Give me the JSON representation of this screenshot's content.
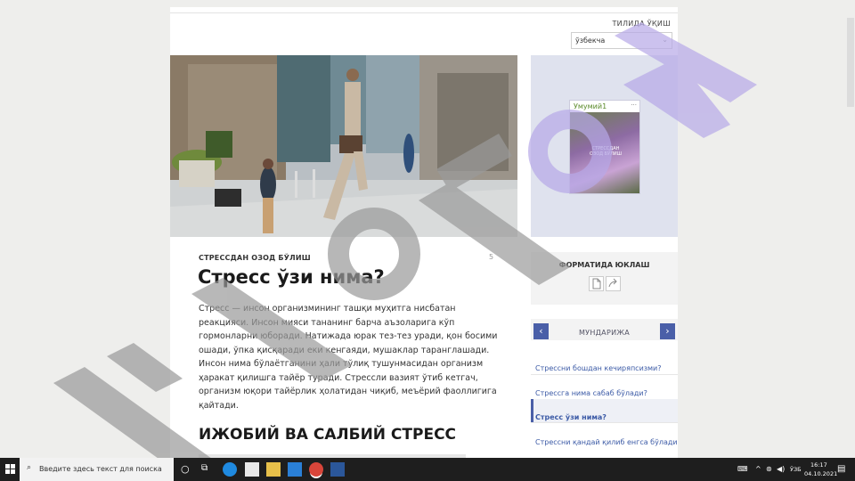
{
  "language": {
    "label": "ТИЛИДА ЎҚИШ",
    "selected": "ўзбекча"
  },
  "hero": {
    "alt": ""
  },
  "promo": {
    "title": "Умумий1",
    "caption": "СТРЕССДАН ОЗОД БЎЛИШ"
  },
  "article": {
    "eyebrow": "СТРЕССДАН ОЗОД БЎЛИШ",
    "marker": "5",
    "title": "Стресс ўзи нима?",
    "paragraph_lines": [
      "Стресс — инсон организмининг ташқи муҳитга нисбатан",
      "реакцияси. Инсон мияси тананинг барча аъзоларига кўп",
      "гормонларни юборади. Натижада юрак тез-тез уради, қон босими",
      "ошади, ўпка қисқаради еки кенгаяди, мушаклар таранглашади.",
      "Инсон нима бўлаётганини ҳали тўлиқ тушунмасидан организм",
      "ҳаракат қилишга тайёр туради. Стрессли вазият ўтиб кетгач,",
      "организм юқори тайёрлик ҳолатидан чиқиб, меъёрий фаоллигига",
      "қайтади."
    ],
    "section_heading": "ИЖОБИЙ ВА САЛБИЙ СТРЕСС"
  },
  "format": {
    "label": "ФОРМАТИДА ЮКЛАШ"
  },
  "toc": {
    "label": "МУНДАРИЖА",
    "prev": "‹",
    "next": "›",
    "items": [
      "Стрессни бошдан кечиряпсизми?",
      "Стрессга нима сабаб бўлади?",
      "Стресс ўзи нима?",
      "Стрессни қандай қилиб енгса бўлади?"
    ],
    "active_index": 2
  },
  "taskbar": {
    "search_placeholder": "Введите здесь текст для поиска",
    "lang": "ЎЗБ",
    "time": "16:17",
    "date": "04.10.2021"
  },
  "colors": {
    "accent": "#4a5fa8",
    "link": "#3b5aa6",
    "watermark_gray": "#9a9a9a",
    "watermark_purple": "#b7a9e8"
  }
}
